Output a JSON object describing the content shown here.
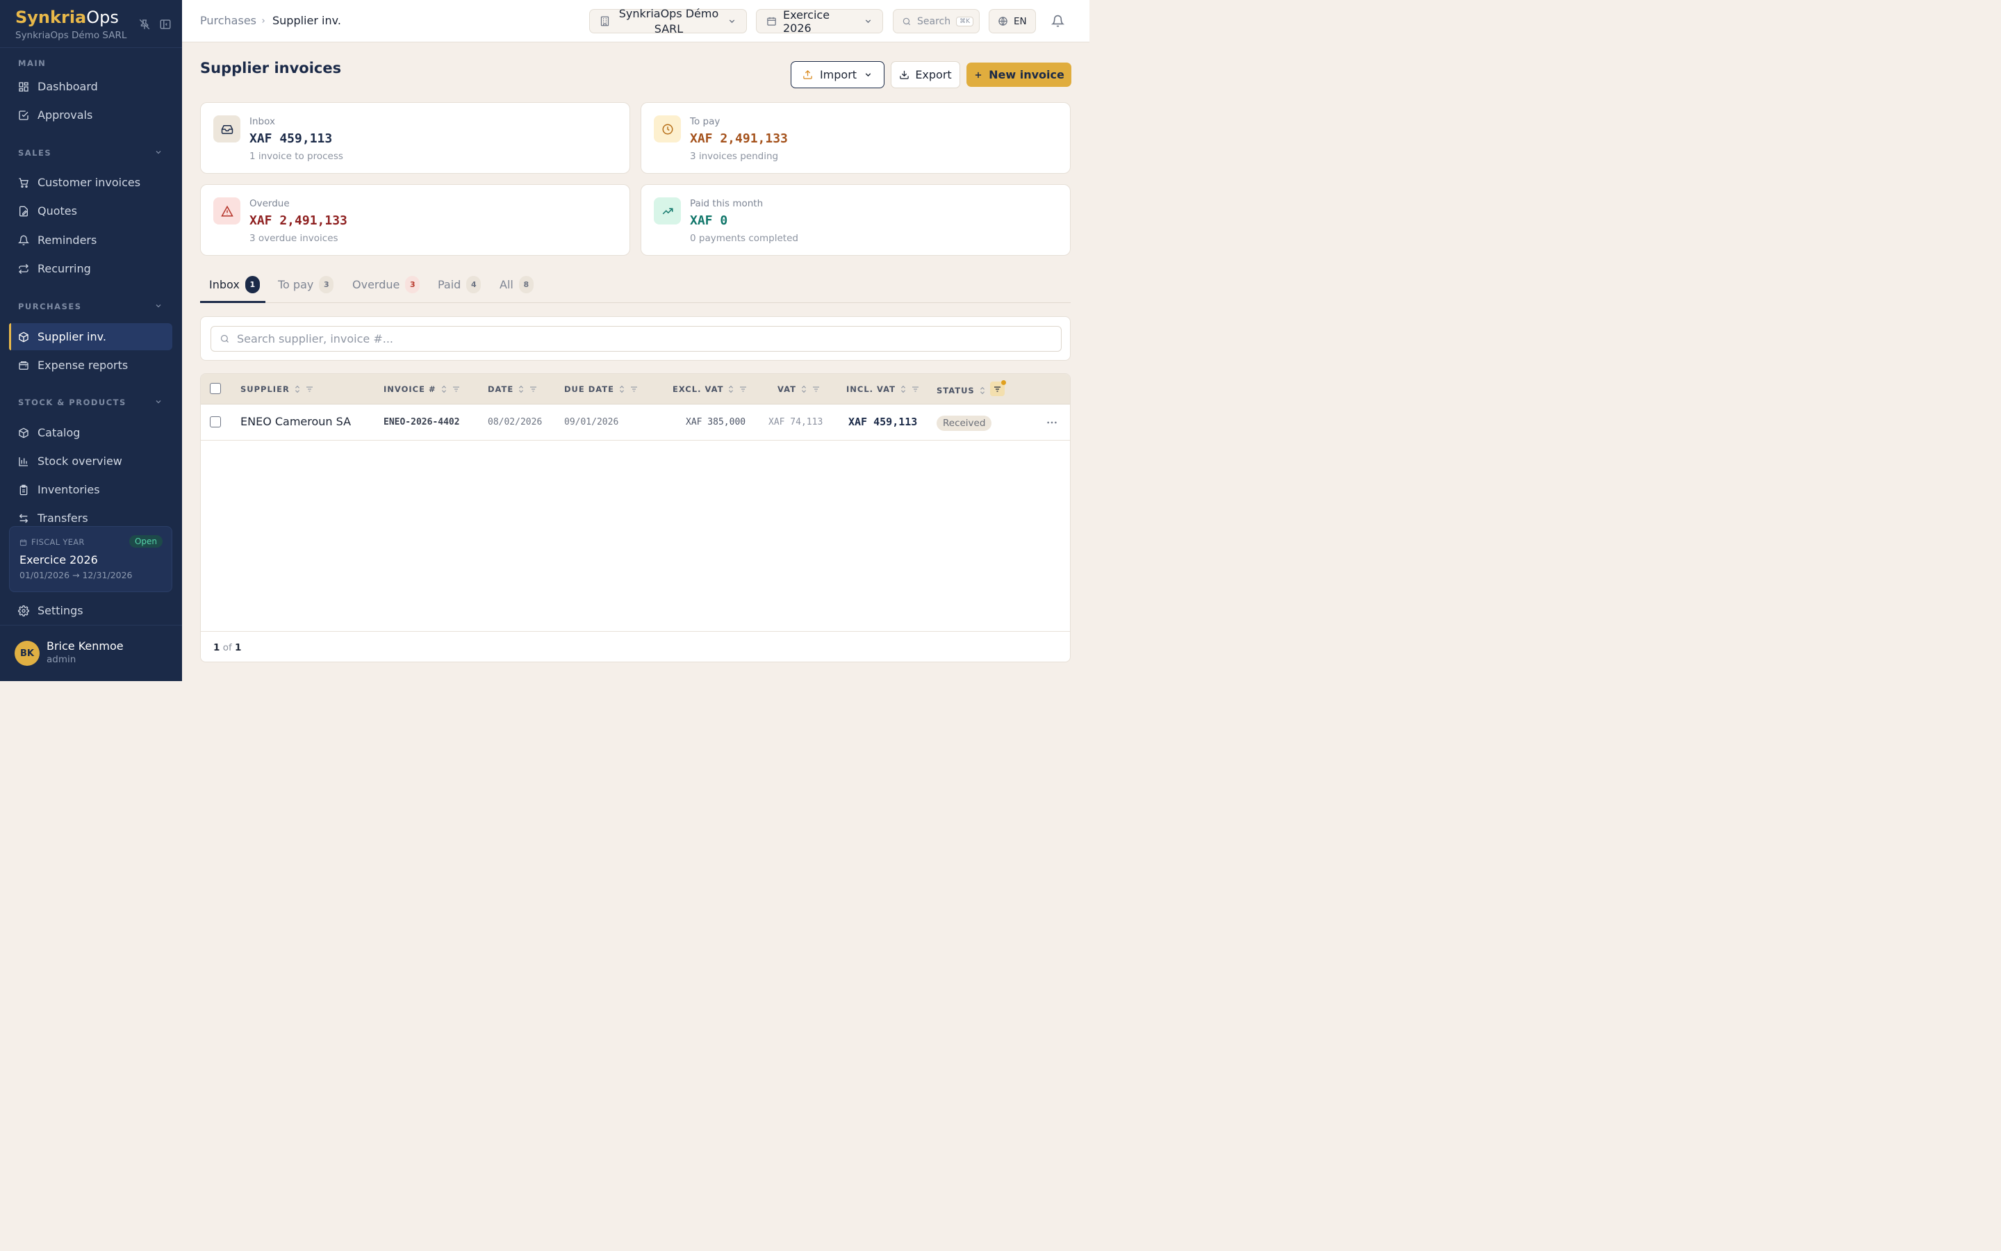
{
  "brand": {
    "name_part1": "Synkria",
    "name_part2": "Ops",
    "company": "SynkriaOps Démo SARL"
  },
  "sidebar": {
    "sections": {
      "main": "MAIN",
      "sales": "SALES",
      "purchases": "PURCHASES",
      "stock": "STOCK & PRODUCTS"
    },
    "items": {
      "dashboard": "Dashboard",
      "approvals": "Approvals",
      "customer_invoices": "Customer invoices",
      "quotes": "Quotes",
      "reminders": "Reminders",
      "recurring": "Recurring",
      "supplier_inv": "Supplier inv.",
      "expense_reports": "Expense reports",
      "catalog": "Catalog",
      "stock_overview": "Stock overview",
      "inventories": "Inventories",
      "transfers": "Transfers",
      "settings": "Settings"
    },
    "fiscal_year": {
      "label": "FISCAL YEAR",
      "status": "Open",
      "name": "Exercice 2026",
      "range": "01/01/2026 → 12/31/2026"
    },
    "user": {
      "initials": "BK",
      "name": "Brice Kenmoe",
      "role": "admin"
    }
  },
  "topbar": {
    "breadcrumb": [
      "Purchases",
      "Supplier inv."
    ],
    "company_select": "SynkriaOps Démo SARL",
    "year_select": "Exercice 2026",
    "search_label": "Search",
    "search_shortcut": "⌘K",
    "language": "EN"
  },
  "page": {
    "title": "Supplier invoices",
    "actions": {
      "import": "Import",
      "export": "Export",
      "new": "New invoice"
    }
  },
  "cards": [
    {
      "label": "Inbox",
      "value": "XAF 459,113",
      "sub": "1 invoice to process",
      "icon": "inbox-icon",
      "color": "#1b2a48"
    },
    {
      "label": "To pay",
      "value": "XAF 2,491,133",
      "sub": "3 invoices pending",
      "icon": "clock-icon",
      "color": "#a4511b"
    },
    {
      "label": "Overdue",
      "value": "XAF 2,491,133",
      "sub": "3 overdue invoices",
      "icon": "alert-triangle-icon",
      "color": "#8e1f1f"
    },
    {
      "label": "Paid this month",
      "value": "XAF 0",
      "sub": "0 payments completed",
      "icon": "trending-up-icon",
      "color": "#10766a"
    }
  ],
  "tabs": [
    {
      "label": "Inbox",
      "count": "1",
      "active": true
    },
    {
      "label": "To pay",
      "count": "3"
    },
    {
      "label": "Overdue",
      "count": "3"
    },
    {
      "label": "Paid",
      "count": "4"
    },
    {
      "label": "All",
      "count": "8"
    }
  ],
  "search": {
    "placeholder": "Search supplier, invoice #..."
  },
  "table": {
    "columns": [
      "SUPPLIER",
      "INVOICE #",
      "DATE",
      "DUE DATE",
      "EXCL. VAT",
      "VAT",
      "INCL. VAT",
      "STATUS"
    ],
    "rows": [
      {
        "supplier": "ENEO Cameroun SA",
        "invoice": "ENEO-2026-4402",
        "date": "08/02/2026",
        "due": "09/01/2026",
        "excl": "XAF 385,000",
        "vat": "XAF 74,113",
        "incl": "XAF 459,113",
        "status": "Received"
      }
    ],
    "pager": {
      "current": "1",
      "of": "of",
      "total": "1"
    }
  },
  "colors": {
    "sidebar": "#1b2a48",
    "accent": "#e0b043",
    "background": "#f5efe9"
  }
}
